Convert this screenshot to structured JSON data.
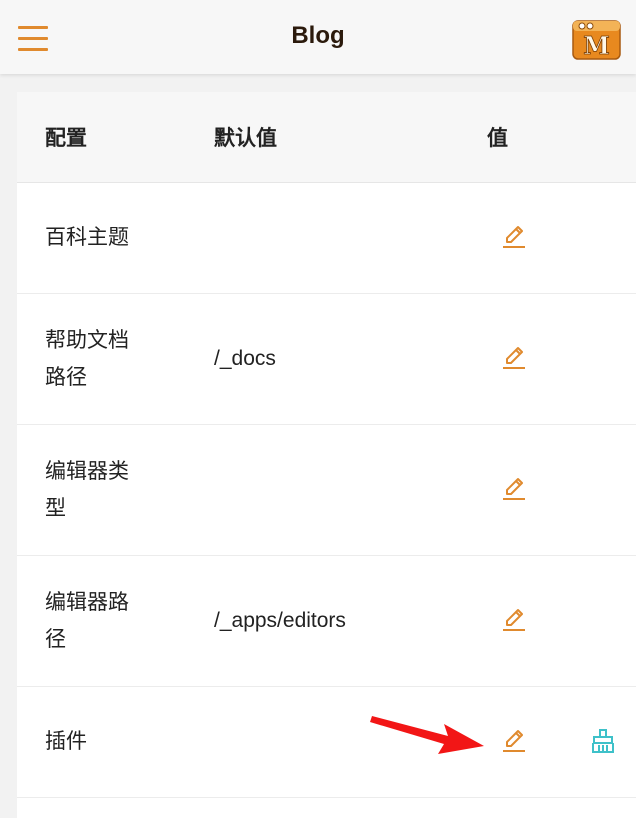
{
  "header": {
    "title": "Blog",
    "menu_icon": "hamburger-menu-icon",
    "logo_letter": "M",
    "accent": "#e08a2e"
  },
  "table": {
    "columns": [
      "配置",
      "默认值",
      "值"
    ],
    "rows": [
      {
        "name": "百科主题",
        "default": "",
        "has_edit": true,
        "has_clean": false
      },
      {
        "name": "帮助文档路径",
        "name_lines": [
          "帮助文档",
          "路径"
        ],
        "default": "/_docs",
        "has_edit": true,
        "has_clean": false
      },
      {
        "name": "编辑器类型",
        "name_lines": [
          "编辑器类",
          "型"
        ],
        "default": "",
        "has_edit": true,
        "has_clean": false
      },
      {
        "name": "编辑器路径",
        "name_lines": [
          "编辑器路",
          "径"
        ],
        "default": "/_apps/editors",
        "has_edit": true,
        "has_clean": false
      },
      {
        "name": "插件",
        "default": "",
        "has_edit": true,
        "has_clean": true
      }
    ]
  },
  "colors": {
    "edit_icon": "#e08a2e",
    "clean_icon": "#3ec1c9",
    "arrow": "#f21616"
  }
}
